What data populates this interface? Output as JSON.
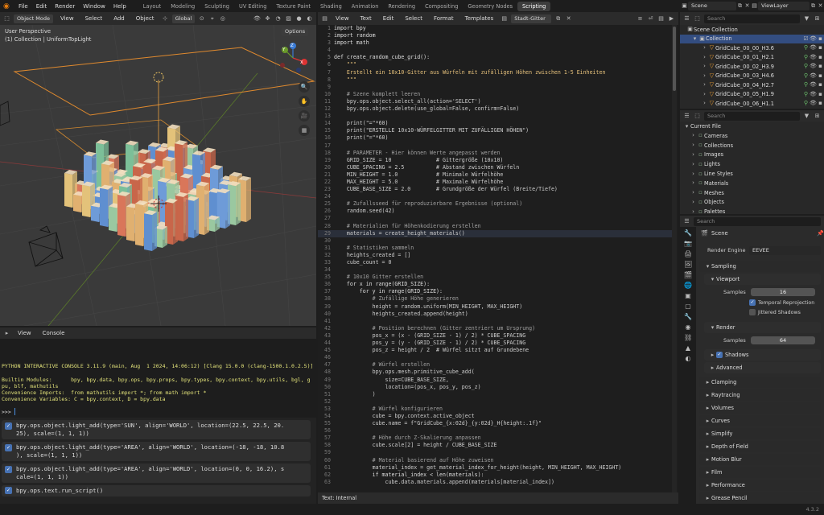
{
  "topbar": {
    "menus": [
      "File",
      "Edit",
      "Render",
      "Window",
      "Help"
    ],
    "workspaces": [
      "Layout",
      "Modeling",
      "Sculpting",
      "UV Editing",
      "Texture Paint",
      "Shading",
      "Animation",
      "Rendering",
      "Compositing",
      "Geometry Nodes",
      "Scripting"
    ],
    "active_workspace": "Scripting",
    "scene": "Scene",
    "view_layer": "ViewLayer"
  },
  "viewport": {
    "mode": "Object Mode",
    "menus": [
      "View",
      "Select",
      "Add",
      "Object"
    ],
    "transform": "Global",
    "options": "Options",
    "perspective": "User Perspective",
    "collection_info": "(1) Collection | UniformTopLight",
    "gizmo": {
      "x": "X",
      "y": "Y",
      "z": "Z"
    }
  },
  "console": {
    "menus": [
      "View",
      "Console"
    ],
    "lines": [
      "PYTHON INTERACTIVE CONSOLE 3.11.9 (main, Aug  1 2024, 14:06:12) [Clang 15.0.0 (clang-1500.1.0.2.5)]",
      "",
      "Builtin Modules:      bpy, bpy.data, bpy.ops, bpy.props, bpy.types, bpy.context, bpy.utils, bgl, g",
      "pu, blf, mathutils",
      "Convenience Imports:  from mathutils import *; from math import *",
      "Convenience Variables: C = bpy.context, D = bpy.data"
    ],
    "prompt": ">>> ",
    "history": [
      "bpy.ops.object.light_add(type='SUN', align='WORLD', location=(22.5, 22.5, 20.\n25), scale=(1, 1, 1))",
      "bpy.ops.object.light_add(type='AREA', align='WORLD', location=(-18, -18, 10.8\n), scale=(1, 1, 1))",
      "bpy.ops.object.light_add(type='AREA', align='WORLD', location=(0, 0, 16.2), s\ncale=(1, 1, 1))",
      "bpy.ops.text.run_script()"
    ]
  },
  "text_editor": {
    "menus": [
      "View",
      "Text",
      "Edit",
      "Select",
      "Format",
      "Templates"
    ],
    "filename": "Stadt-Gitter",
    "status": "Text: Internal",
    "current_line": 29,
    "lines": [
      "import bpy",
      "import random",
      "import math",
      "",
      "def create_random_cube_grid():",
      "    \"\"\"",
      "    Erstellt ein 10x10-Gitter aus Würfeln mit zufälligen Höhen zwischen 1-5 Einheiten",
      "    \"\"\"",
      "",
      "    # Szene komplett leeren",
      "    bpy.ops.object.select_all(action='SELECT')",
      "    bpy.ops.object.delete(use_global=False, confirm=False)",
      "",
      "    print(\"=\"*60)",
      "    print(\"ERSTELLE 10x10-WÜRFELGITTER MIT ZUFÄLLIGEN HÖHEN\")",
      "    print(\"=\"*60)",
      "",
      "    # PARAMETER - Hier können Werte angepasst werden",
      "    GRID_SIZE = 10              # Gittergröße (10x10)",
      "    CUBE_SPACING = 2.5          # Abstand zwischen Würfeln",
      "    MIN_HEIGHT = 1.0            # Minimale Würfelhöhe",
      "    MAX_HEIGHT = 5.0            # Maximale Würfelhöhe",
      "    CUBE_BASE_SIZE = 2.0        # Grundgröße der Würfel (Breite/Tiefe)",
      "",
      "    # Zufallsseed für reproduzierbare Ergebnisse (optional)",
      "    random.seed(42)",
      "",
      "    # Materialien für Höhenkodierung erstellen",
      "    materials = create_height_materials()",
      "",
      "    # Statistiken sammeln",
      "    heights_created = []",
      "    cube_count = 0",
      "",
      "    # 10x10 Gitter erstellen",
      "    for x in range(GRID_SIZE):",
      "        for y in range(GRID_SIZE):",
      "            # Zufällige Höhe generieren",
      "            height = random.uniform(MIN_HEIGHT, MAX_HEIGHT)",
      "            heights_created.append(height)",
      "",
      "            # Position berechnen (Gitter zentriert um Ursprung)",
      "            pos_x = (x - (GRID_SIZE - 1) / 2) * CUBE_SPACING",
      "            pos_y = (y - (GRID_SIZE - 1) / 2) * CUBE_SPACING",
      "            pos_z = height / 2  # Würfel sitzt auf Grundebene",
      "",
      "            # Würfel erstellen",
      "            bpy.ops.mesh.primitive_cube_add(",
      "                size=CUBE_BASE_SIZE,",
      "                location=(pos_x, pos_y, pos_z)",
      "            )",
      "",
      "            # Würfel konfigurieren",
      "            cube = bpy.context.active_object",
      "            cube.name = f\"GridCube_{x:02d}_{y:02d}_H{height:.1f}\"",
      "",
      "            # Höhe durch Z-Skalierung anpassen",
      "            cube.scale[2] = height / CUBE_BASE_SIZE",
      "",
      "            # Material basierend auf Höhe zuweisen",
      "            material_index = get_material_index_for_height(height, MIN_HEIGHT, MAX_HEIGHT)",
      "            if material_index < len(materials):",
      "                cube.data.materials.append(materials[material_index])"
    ]
  },
  "outliner": {
    "search_placeholder": "Search",
    "root": "Scene Collection",
    "collection": "Collection",
    "items": [
      "GridCube_00_00_H3.6",
      "GridCube_00_01_H2.1",
      "GridCube_00_02_H3.9",
      "GridCube_00_03_H4.6",
      "GridCube_00_04_H2.7",
      "GridCube_00_05_H1.9",
      "GridCube_00_06_H1.1"
    ]
  },
  "data_browser": {
    "search_placeholder": "Search",
    "root": "Current File",
    "items": [
      "Cameras",
      "Collections",
      "Images",
      "Lights",
      "Line Styles",
      "Materials",
      "Meshes",
      "Objects",
      "Palettes"
    ]
  },
  "properties": {
    "search_placeholder": "Search",
    "scene": "Scene",
    "render_engine_label": "Render Engine",
    "render_engine": "EEVEE",
    "sampling": "Sampling",
    "viewport": "Viewport",
    "samples_label": "Samples",
    "viewport_samples": "16",
    "temporal_reprojection": "Temporal Reprojection",
    "jittered_shadows": "Jittered Shadows",
    "render": "Render",
    "render_samples": "64",
    "shadows": "Shadows",
    "advanced": "Advanced",
    "sections": [
      "Clamping",
      "Raytracing",
      "Volumes",
      "Curves",
      "Simplify",
      "Depth of Field",
      "Motion Blur",
      "Film",
      "Performance",
      "Grease Pencil"
    ]
  },
  "statusbar": {
    "version": "4.3.2"
  }
}
